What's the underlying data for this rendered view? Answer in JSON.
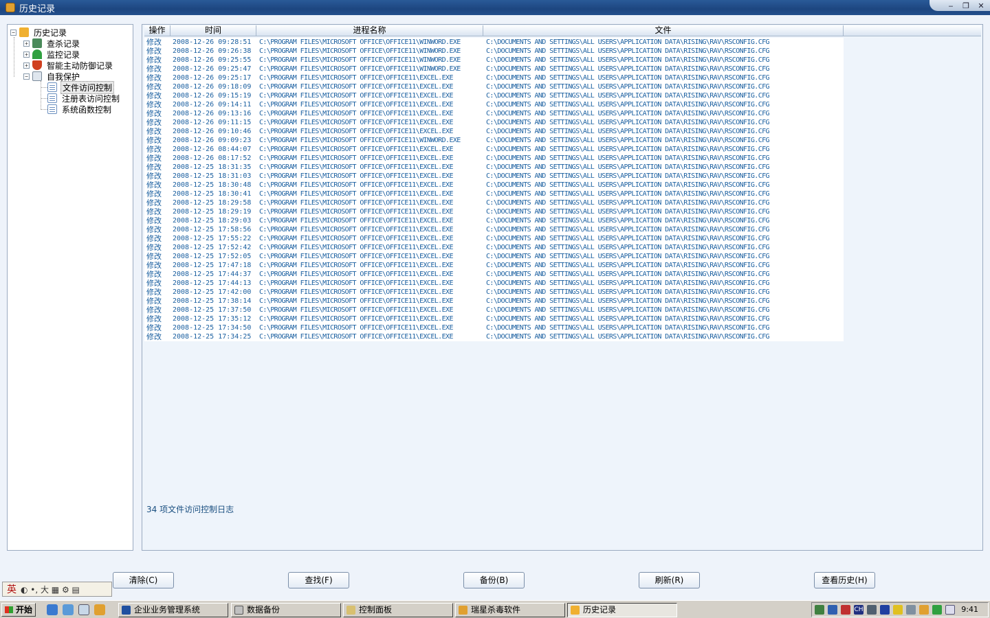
{
  "window": {
    "title": "历史记录",
    "minimize": "‒",
    "restore": "❐",
    "close": "✕"
  },
  "tree": {
    "root": "历史记录",
    "items": [
      "查杀记录",
      "监控记录",
      "智能主动防御记录",
      "自我保护"
    ],
    "children": [
      "文件访问控制",
      "注册表访问控制",
      "系统函数控制"
    ],
    "selected": "文件访问控制"
  },
  "table": {
    "columns": [
      "操作",
      "时间",
      "进程名称",
      "文件"
    ],
    "rows": [
      [
        "修改",
        "2008-12-26 09:28:51",
        "C:\\PROGRAM FILES\\MICROSOFT OFFICE\\OFFICE11\\WINWORD.EXE",
        "C:\\DOCUMENTS AND SETTINGS\\ALL USERS\\APPLICATION DATA\\RISING\\RAV\\RSCONFIG.CFG"
      ],
      [
        "修改",
        "2008-12-26 09:26:38",
        "C:\\PROGRAM FILES\\MICROSOFT OFFICE\\OFFICE11\\WINWORD.EXE",
        "C:\\DOCUMENTS AND SETTINGS\\ALL USERS\\APPLICATION DATA\\RISING\\RAV\\RSCONFIG.CFG"
      ],
      [
        "修改",
        "2008-12-26 09:25:55",
        "C:\\PROGRAM FILES\\MICROSOFT OFFICE\\OFFICE11\\WINWORD.EXE",
        "C:\\DOCUMENTS AND SETTINGS\\ALL USERS\\APPLICATION DATA\\RISING\\RAV\\RSCONFIG.CFG"
      ],
      [
        "修改",
        "2008-12-26 09:25:47",
        "C:\\PROGRAM FILES\\MICROSOFT OFFICE\\OFFICE11\\WINWORD.EXE",
        "C:\\DOCUMENTS AND SETTINGS\\ALL USERS\\APPLICATION DATA\\RISING\\RAV\\RSCONFIG.CFG"
      ],
      [
        "修改",
        "2008-12-26 09:25:17",
        "C:\\PROGRAM FILES\\MICROSOFT OFFICE\\OFFICE11\\EXCEL.EXE",
        "C:\\DOCUMENTS AND SETTINGS\\ALL USERS\\APPLICATION DATA\\RISING\\RAV\\RSCONFIG.CFG"
      ],
      [
        "修改",
        "2008-12-26 09:18:09",
        "C:\\PROGRAM FILES\\MICROSOFT OFFICE\\OFFICE11\\EXCEL.EXE",
        "C:\\DOCUMENTS AND SETTINGS\\ALL USERS\\APPLICATION DATA\\RISING\\RAV\\RSCONFIG.CFG"
      ],
      [
        "修改",
        "2008-12-26 09:15:19",
        "C:\\PROGRAM FILES\\MICROSOFT OFFICE\\OFFICE11\\EXCEL.EXE",
        "C:\\DOCUMENTS AND SETTINGS\\ALL USERS\\APPLICATION DATA\\RISING\\RAV\\RSCONFIG.CFG"
      ],
      [
        "修改",
        "2008-12-26 09:14:11",
        "C:\\PROGRAM FILES\\MICROSOFT OFFICE\\OFFICE11\\EXCEL.EXE",
        "C:\\DOCUMENTS AND SETTINGS\\ALL USERS\\APPLICATION DATA\\RISING\\RAV\\RSCONFIG.CFG"
      ],
      [
        "修改",
        "2008-12-26 09:13:16",
        "C:\\PROGRAM FILES\\MICROSOFT OFFICE\\OFFICE11\\EXCEL.EXE",
        "C:\\DOCUMENTS AND SETTINGS\\ALL USERS\\APPLICATION DATA\\RISING\\RAV\\RSCONFIG.CFG"
      ],
      [
        "修改",
        "2008-12-26 09:11:15",
        "C:\\PROGRAM FILES\\MICROSOFT OFFICE\\OFFICE11\\EXCEL.EXE",
        "C:\\DOCUMENTS AND SETTINGS\\ALL USERS\\APPLICATION DATA\\RISING\\RAV\\RSCONFIG.CFG"
      ],
      [
        "修改",
        "2008-12-26 09:10:46",
        "C:\\PROGRAM FILES\\MICROSOFT OFFICE\\OFFICE11\\EXCEL.EXE",
        "C:\\DOCUMENTS AND SETTINGS\\ALL USERS\\APPLICATION DATA\\RISING\\RAV\\RSCONFIG.CFG"
      ],
      [
        "修改",
        "2008-12-26 09:09:23",
        "C:\\PROGRAM FILES\\MICROSOFT OFFICE\\OFFICE11\\WINWORD.EXE",
        "C:\\DOCUMENTS AND SETTINGS\\ALL USERS\\APPLICATION DATA\\RISING\\RAV\\RSCONFIG.CFG"
      ],
      [
        "修改",
        "2008-12-26 08:44:07",
        "C:\\PROGRAM FILES\\MICROSOFT OFFICE\\OFFICE11\\EXCEL.EXE",
        "C:\\DOCUMENTS AND SETTINGS\\ALL USERS\\APPLICATION DATA\\RISING\\RAV\\RSCONFIG.CFG"
      ],
      [
        "修改",
        "2008-12-26 08:17:52",
        "C:\\PROGRAM FILES\\MICROSOFT OFFICE\\OFFICE11\\EXCEL.EXE",
        "C:\\DOCUMENTS AND SETTINGS\\ALL USERS\\APPLICATION DATA\\RISING\\RAV\\RSCONFIG.CFG"
      ],
      [
        "修改",
        "2008-12-25 18:31:35",
        "C:\\PROGRAM FILES\\MICROSOFT OFFICE\\OFFICE11\\EXCEL.EXE",
        "C:\\DOCUMENTS AND SETTINGS\\ALL USERS\\APPLICATION DATA\\RISING\\RAV\\RSCONFIG.CFG"
      ],
      [
        "修改",
        "2008-12-25 18:31:03",
        "C:\\PROGRAM FILES\\MICROSOFT OFFICE\\OFFICE11\\EXCEL.EXE",
        "C:\\DOCUMENTS AND SETTINGS\\ALL USERS\\APPLICATION DATA\\RISING\\RAV\\RSCONFIG.CFG"
      ],
      [
        "修改",
        "2008-12-25 18:30:48",
        "C:\\PROGRAM FILES\\MICROSOFT OFFICE\\OFFICE11\\EXCEL.EXE",
        "C:\\DOCUMENTS AND SETTINGS\\ALL USERS\\APPLICATION DATA\\RISING\\RAV\\RSCONFIG.CFG"
      ],
      [
        "修改",
        "2008-12-25 18:30:41",
        "C:\\PROGRAM FILES\\MICROSOFT OFFICE\\OFFICE11\\EXCEL.EXE",
        "C:\\DOCUMENTS AND SETTINGS\\ALL USERS\\APPLICATION DATA\\RISING\\RAV\\RSCONFIG.CFG"
      ],
      [
        "修改",
        "2008-12-25 18:29:58",
        "C:\\PROGRAM FILES\\MICROSOFT OFFICE\\OFFICE11\\EXCEL.EXE",
        "C:\\DOCUMENTS AND SETTINGS\\ALL USERS\\APPLICATION DATA\\RISING\\RAV\\RSCONFIG.CFG"
      ],
      [
        "修改",
        "2008-12-25 18:29:19",
        "C:\\PROGRAM FILES\\MICROSOFT OFFICE\\OFFICE11\\EXCEL.EXE",
        "C:\\DOCUMENTS AND SETTINGS\\ALL USERS\\APPLICATION DATA\\RISING\\RAV\\RSCONFIG.CFG"
      ],
      [
        "修改",
        "2008-12-25 18:29:03",
        "C:\\PROGRAM FILES\\MICROSOFT OFFICE\\OFFICE11\\EXCEL.EXE",
        "C:\\DOCUMENTS AND SETTINGS\\ALL USERS\\APPLICATION DATA\\RISING\\RAV\\RSCONFIG.CFG"
      ],
      [
        "修改",
        "2008-12-25 17:58:56",
        "C:\\PROGRAM FILES\\MICROSOFT OFFICE\\OFFICE11\\EXCEL.EXE",
        "C:\\DOCUMENTS AND SETTINGS\\ALL USERS\\APPLICATION DATA\\RISING\\RAV\\RSCONFIG.CFG"
      ],
      [
        "修改",
        "2008-12-25 17:55:22",
        "C:\\PROGRAM FILES\\MICROSOFT OFFICE\\OFFICE11\\EXCEL.EXE",
        "C:\\DOCUMENTS AND SETTINGS\\ALL USERS\\APPLICATION DATA\\RISING\\RAV\\RSCONFIG.CFG"
      ],
      [
        "修改",
        "2008-12-25 17:52:42",
        "C:\\PROGRAM FILES\\MICROSOFT OFFICE\\OFFICE11\\EXCEL.EXE",
        "C:\\DOCUMENTS AND SETTINGS\\ALL USERS\\APPLICATION DATA\\RISING\\RAV\\RSCONFIG.CFG"
      ],
      [
        "修改",
        "2008-12-25 17:52:05",
        "C:\\PROGRAM FILES\\MICROSOFT OFFICE\\OFFICE11\\EXCEL.EXE",
        "C:\\DOCUMENTS AND SETTINGS\\ALL USERS\\APPLICATION DATA\\RISING\\RAV\\RSCONFIG.CFG"
      ],
      [
        "修改",
        "2008-12-25 17:47:18",
        "C:\\PROGRAM FILES\\MICROSOFT OFFICE\\OFFICE11\\EXCEL.EXE",
        "C:\\DOCUMENTS AND SETTINGS\\ALL USERS\\APPLICATION DATA\\RISING\\RAV\\RSCONFIG.CFG"
      ],
      [
        "修改",
        "2008-12-25 17:44:37",
        "C:\\PROGRAM FILES\\MICROSOFT OFFICE\\OFFICE11\\EXCEL.EXE",
        "C:\\DOCUMENTS AND SETTINGS\\ALL USERS\\APPLICATION DATA\\RISING\\RAV\\RSCONFIG.CFG"
      ],
      [
        "修改",
        "2008-12-25 17:44:13",
        "C:\\PROGRAM FILES\\MICROSOFT OFFICE\\OFFICE11\\EXCEL.EXE",
        "C:\\DOCUMENTS AND SETTINGS\\ALL USERS\\APPLICATION DATA\\RISING\\RAV\\RSCONFIG.CFG"
      ],
      [
        "修改",
        "2008-12-25 17:42:00",
        "C:\\PROGRAM FILES\\MICROSOFT OFFICE\\OFFICE11\\EXCEL.EXE",
        "C:\\DOCUMENTS AND SETTINGS\\ALL USERS\\APPLICATION DATA\\RISING\\RAV\\RSCONFIG.CFG"
      ],
      [
        "修改",
        "2008-12-25 17:38:14",
        "C:\\PROGRAM FILES\\MICROSOFT OFFICE\\OFFICE11\\EXCEL.EXE",
        "C:\\DOCUMENTS AND SETTINGS\\ALL USERS\\APPLICATION DATA\\RISING\\RAV\\RSCONFIG.CFG"
      ],
      [
        "修改",
        "2008-12-25 17:37:50",
        "C:\\PROGRAM FILES\\MICROSOFT OFFICE\\OFFICE11\\EXCEL.EXE",
        "C:\\DOCUMENTS AND SETTINGS\\ALL USERS\\APPLICATION DATA\\RISING\\RAV\\RSCONFIG.CFG"
      ],
      [
        "修改",
        "2008-12-25 17:35:12",
        "C:\\PROGRAM FILES\\MICROSOFT OFFICE\\OFFICE11\\EXCEL.EXE",
        "C:\\DOCUMENTS AND SETTINGS\\ALL USERS\\APPLICATION DATA\\RISING\\RAV\\RSCONFIG.CFG"
      ],
      [
        "修改",
        "2008-12-25 17:34:50",
        "C:\\PROGRAM FILES\\MICROSOFT OFFICE\\OFFICE11\\EXCEL.EXE",
        "C:\\DOCUMENTS AND SETTINGS\\ALL USERS\\APPLICATION DATA\\RISING\\RAV\\RSCONFIG.CFG"
      ],
      [
        "修改",
        "2008-12-25 17:34:25",
        "C:\\PROGRAM FILES\\MICROSOFT OFFICE\\OFFICE11\\EXCEL.EXE",
        "C:\\DOCUMENTS AND SETTINGS\\ALL USERS\\APPLICATION DATA\\RISING\\RAV\\RSCONFIG.CFG"
      ]
    ],
    "status": "34 项文件访问控制日志"
  },
  "buttons": {
    "clear": "清除(C)",
    "find": "查找(F)",
    "backup": "备份(B)",
    "refresh": "刷新(R)",
    "history": "查看历史(H)"
  },
  "ime": {
    "mode": "英",
    "items": "◐ •, 大 ▦ ⚙ ▤"
  },
  "taskbar": {
    "start": "开始",
    "tasks": [
      "企业业务管理系统",
      "数据备份",
      "控制面板",
      "瑞星杀毒软件",
      "历史记录"
    ],
    "active": "历史记录",
    "clock": "9:41",
    "tray_lang": "CH"
  },
  "colors": {
    "row_text": "#1a5fa0",
    "titlebar": "#1d4680"
  }
}
